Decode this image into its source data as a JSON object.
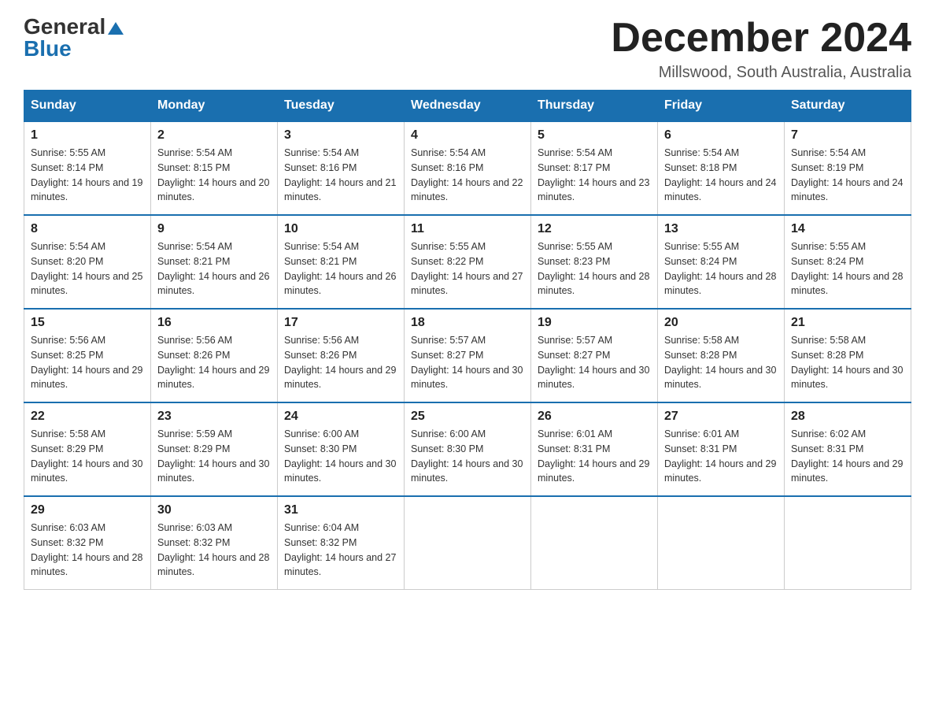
{
  "logo": {
    "general": "General",
    "blue": "Blue"
  },
  "header": {
    "month_year": "December 2024",
    "location": "Millswood, South Australia, Australia"
  },
  "weekdays": [
    "Sunday",
    "Monday",
    "Tuesday",
    "Wednesday",
    "Thursday",
    "Friday",
    "Saturday"
  ],
  "weeks": [
    [
      {
        "day": "1",
        "sunrise": "5:55 AM",
        "sunset": "8:14 PM",
        "daylight": "14 hours and 19 minutes."
      },
      {
        "day": "2",
        "sunrise": "5:54 AM",
        "sunset": "8:15 PM",
        "daylight": "14 hours and 20 minutes."
      },
      {
        "day": "3",
        "sunrise": "5:54 AM",
        "sunset": "8:16 PM",
        "daylight": "14 hours and 21 minutes."
      },
      {
        "day": "4",
        "sunrise": "5:54 AM",
        "sunset": "8:16 PM",
        "daylight": "14 hours and 22 minutes."
      },
      {
        "day": "5",
        "sunrise": "5:54 AM",
        "sunset": "8:17 PM",
        "daylight": "14 hours and 23 minutes."
      },
      {
        "day": "6",
        "sunrise": "5:54 AM",
        "sunset": "8:18 PM",
        "daylight": "14 hours and 24 minutes."
      },
      {
        "day": "7",
        "sunrise": "5:54 AM",
        "sunset": "8:19 PM",
        "daylight": "14 hours and 24 minutes."
      }
    ],
    [
      {
        "day": "8",
        "sunrise": "5:54 AM",
        "sunset": "8:20 PM",
        "daylight": "14 hours and 25 minutes."
      },
      {
        "day": "9",
        "sunrise": "5:54 AM",
        "sunset": "8:21 PM",
        "daylight": "14 hours and 26 minutes."
      },
      {
        "day": "10",
        "sunrise": "5:54 AM",
        "sunset": "8:21 PM",
        "daylight": "14 hours and 26 minutes."
      },
      {
        "day": "11",
        "sunrise": "5:55 AM",
        "sunset": "8:22 PM",
        "daylight": "14 hours and 27 minutes."
      },
      {
        "day": "12",
        "sunrise": "5:55 AM",
        "sunset": "8:23 PM",
        "daylight": "14 hours and 28 minutes."
      },
      {
        "day": "13",
        "sunrise": "5:55 AM",
        "sunset": "8:24 PM",
        "daylight": "14 hours and 28 minutes."
      },
      {
        "day": "14",
        "sunrise": "5:55 AM",
        "sunset": "8:24 PM",
        "daylight": "14 hours and 28 minutes."
      }
    ],
    [
      {
        "day": "15",
        "sunrise": "5:56 AM",
        "sunset": "8:25 PM",
        "daylight": "14 hours and 29 minutes."
      },
      {
        "day": "16",
        "sunrise": "5:56 AM",
        "sunset": "8:26 PM",
        "daylight": "14 hours and 29 minutes."
      },
      {
        "day": "17",
        "sunrise": "5:56 AM",
        "sunset": "8:26 PM",
        "daylight": "14 hours and 29 minutes."
      },
      {
        "day": "18",
        "sunrise": "5:57 AM",
        "sunset": "8:27 PM",
        "daylight": "14 hours and 30 minutes."
      },
      {
        "day": "19",
        "sunrise": "5:57 AM",
        "sunset": "8:27 PM",
        "daylight": "14 hours and 30 minutes."
      },
      {
        "day": "20",
        "sunrise": "5:58 AM",
        "sunset": "8:28 PM",
        "daylight": "14 hours and 30 minutes."
      },
      {
        "day": "21",
        "sunrise": "5:58 AM",
        "sunset": "8:28 PM",
        "daylight": "14 hours and 30 minutes."
      }
    ],
    [
      {
        "day": "22",
        "sunrise": "5:58 AM",
        "sunset": "8:29 PM",
        "daylight": "14 hours and 30 minutes."
      },
      {
        "day": "23",
        "sunrise": "5:59 AM",
        "sunset": "8:29 PM",
        "daylight": "14 hours and 30 minutes."
      },
      {
        "day": "24",
        "sunrise": "6:00 AM",
        "sunset": "8:30 PM",
        "daylight": "14 hours and 30 minutes."
      },
      {
        "day": "25",
        "sunrise": "6:00 AM",
        "sunset": "8:30 PM",
        "daylight": "14 hours and 30 minutes."
      },
      {
        "day": "26",
        "sunrise": "6:01 AM",
        "sunset": "8:31 PM",
        "daylight": "14 hours and 29 minutes."
      },
      {
        "day": "27",
        "sunrise": "6:01 AM",
        "sunset": "8:31 PM",
        "daylight": "14 hours and 29 minutes."
      },
      {
        "day": "28",
        "sunrise": "6:02 AM",
        "sunset": "8:31 PM",
        "daylight": "14 hours and 29 minutes."
      }
    ],
    [
      {
        "day": "29",
        "sunrise": "6:03 AM",
        "sunset": "8:32 PM",
        "daylight": "14 hours and 28 minutes."
      },
      {
        "day": "30",
        "sunrise": "6:03 AM",
        "sunset": "8:32 PM",
        "daylight": "14 hours and 28 minutes."
      },
      {
        "day": "31",
        "sunrise": "6:04 AM",
        "sunset": "8:32 PM",
        "daylight": "14 hours and 27 minutes."
      },
      null,
      null,
      null,
      null
    ]
  ]
}
